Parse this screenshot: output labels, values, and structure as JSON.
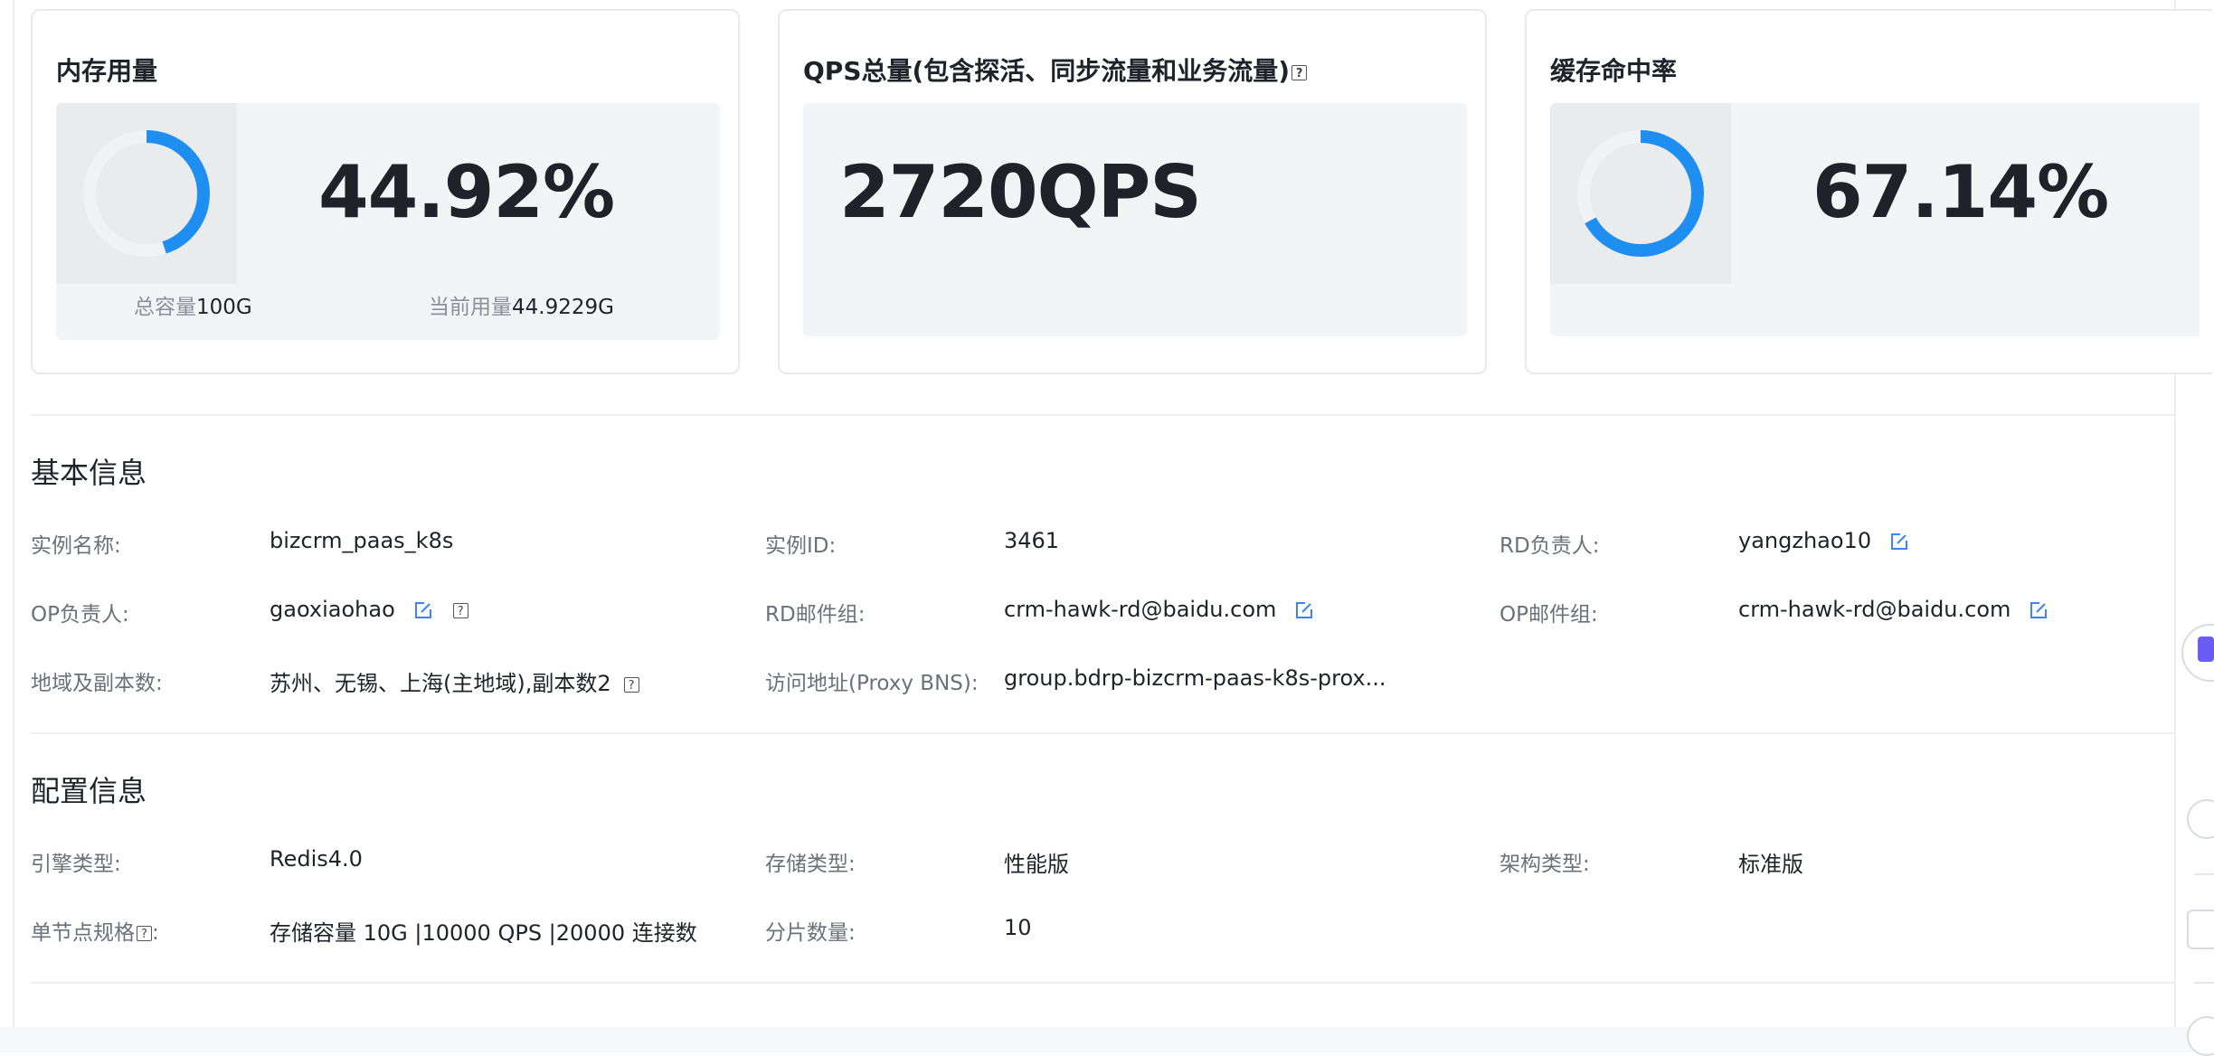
{
  "cards": [
    {
      "title": "内存用量",
      "value": "44.92%",
      "ratio": 0.4492,
      "footer": [
        {
          "label": "总容量",
          "value": "100G"
        },
        {
          "label": "当前用量",
          "value": "44.9229G"
        }
      ]
    },
    {
      "title": "QPS总量(包含探活、同步流量和业务流量)",
      "value": "2720QPS",
      "help_icon": "question-icon"
    },
    {
      "title": "缓存命中率",
      "value": "67.14%",
      "ratio": 0.6714
    }
  ],
  "basic": {
    "title": "基本信息",
    "fields": [
      {
        "label": "实例名称:",
        "value": "bizcrm_paas_k8s"
      },
      {
        "label": "实例ID:",
        "value": "3461"
      },
      {
        "label": "RD负责人:",
        "value": "yangzhao10",
        "icon": "edit-icon"
      },
      {
        "label": "OP负责人:",
        "value": "gaoxiaohao",
        "icon": "edit-icon",
        "help_icon": "question-icon"
      },
      {
        "label": "RD邮件组:",
        "value": "crm-hawk-rd@baidu.com",
        "icon": "edit-icon"
      },
      {
        "label": "OP邮件组:",
        "value": "crm-hawk-rd@baidu.com",
        "icon": "edit-icon"
      },
      {
        "label": "地域及副本数:",
        "value": "苏州、无锡、上海(主地域),副本数2",
        "help_icon": "question-icon"
      },
      {
        "label": "访问地址(Proxy BNS):",
        "value": "group.bdrp-bizcrm-paas-k8s-prox..."
      }
    ]
  },
  "config": {
    "title": "配置信息",
    "fields": [
      {
        "label": "引擎类型:",
        "value": "Redis4.0"
      },
      {
        "label": "存储类型:",
        "value": "性能版"
      },
      {
        "label": "架构类型:",
        "value": "标准版"
      },
      {
        "label": "单节点规格",
        "label_suffix": ":",
        "value": "存储容量 10G |10000 QPS |20000 连接数",
        "help_icon": "question-icon"
      },
      {
        "label": "分片数量:",
        "value": "10"
      }
    ]
  },
  "colors": {
    "accent": "#1e8ff0",
    "track": "#f1f2f4",
    "panel": "#f3f4f6",
    "edit": "#3e82f7"
  }
}
